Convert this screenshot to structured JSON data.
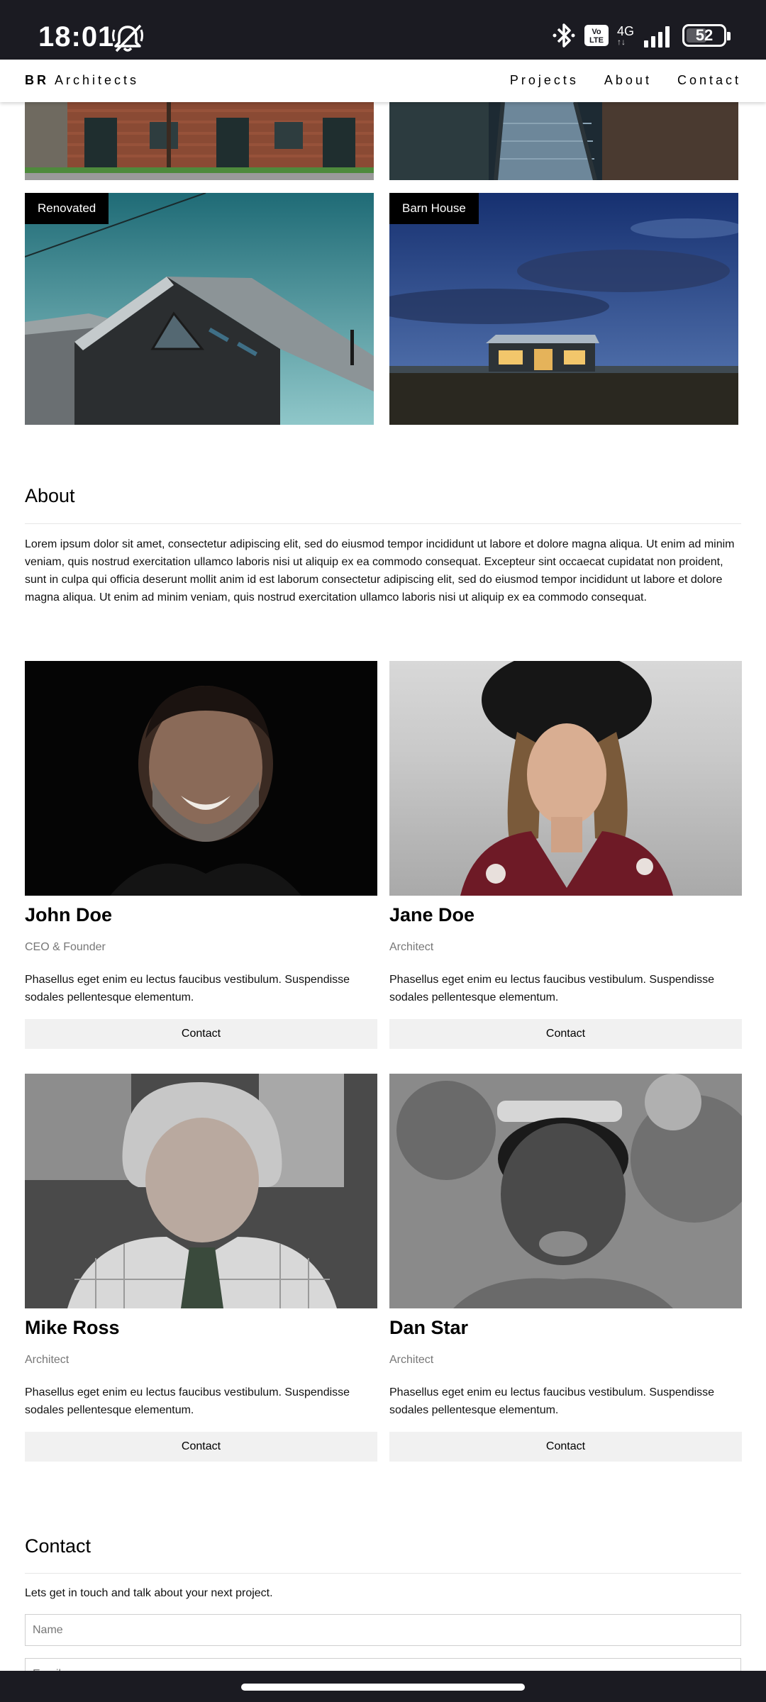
{
  "status": {
    "time": "18:01",
    "network": "4G",
    "volte_top": "Vo",
    "volte_bottom": "LTE",
    "battery": "52"
  },
  "nav": {
    "brand_bold": "BR",
    "brand_rest": "Architects",
    "links": [
      "Projects",
      "About",
      "Contact"
    ]
  },
  "projects": [
    {
      "label": ""
    },
    {
      "label": ""
    },
    {
      "label": "Renovated"
    },
    {
      "label": "Barn House"
    }
  ],
  "about": {
    "title": "About",
    "text": "Lorem ipsum dolor sit amet, consectetur adipiscing elit, sed do eiusmod tempor incididunt ut labore et dolore magna aliqua. Ut enim ad minim veniam, quis nostrud exercitation ullamco laboris nisi ut aliquip ex ea commodo consequat. Excepteur sint occaecat cupidatat non proident, sunt in culpa qui officia deserunt mollit anim id est laborum consectetur adipiscing elit, sed do eiusmod tempor incididunt ut labore et dolore magna aliqua. Ut enim ad minim veniam, quis nostrud exercitation ullamco laboris nisi ut aliquip ex ea commodo consequat."
  },
  "team": [
    {
      "name": "John Doe",
      "role": "CEO & Founder",
      "desc": "Phasellus eget enim eu lectus faucibus vestibulum. Suspendisse sodales pellentesque elementum.",
      "button": "Contact"
    },
    {
      "name": "Jane Doe",
      "role": "Architect",
      "desc": "Phasellus eget enim eu lectus faucibus vestibulum. Suspendisse sodales pellentesque elementum.",
      "button": "Contact"
    },
    {
      "name": "Mike Ross",
      "role": "Architect",
      "desc": "Phasellus eget enim eu lectus faucibus vestibulum. Suspendisse sodales pellentesque elementum.",
      "button": "Contact"
    },
    {
      "name": "Dan Star",
      "role": "Architect",
      "desc": "Phasellus eget enim eu lectus faucibus vestibulum. Suspendisse sodales pellentesque elementum.",
      "button": "Contact"
    }
  ],
  "contact": {
    "title": "Contact",
    "text": "Lets get in touch and talk about your next project.",
    "name_placeholder": "Name",
    "email_placeholder": "Email"
  }
}
